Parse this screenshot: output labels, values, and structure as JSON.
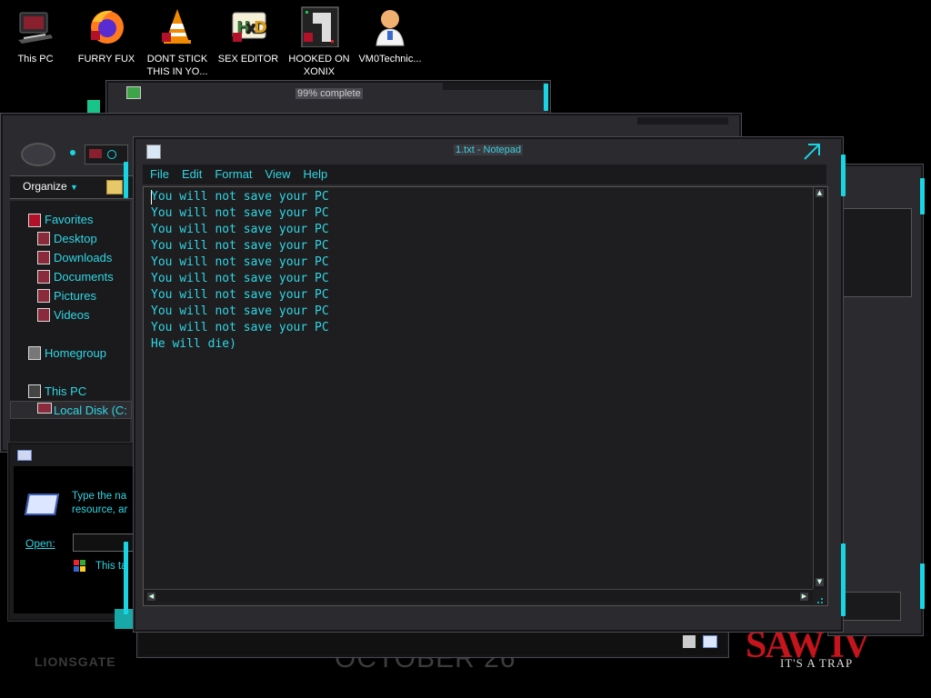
{
  "desktop": {
    "icons": [
      {
        "label_line1": "This PC",
        "label_line2": ""
      },
      {
        "label_line1": "FURRY FUX",
        "label_line2": ""
      },
      {
        "label_line1": "DONT STICK",
        "label_line2": "THIS IN YO..."
      },
      {
        "label_line1": "SEX EDITOR",
        "label_line2": ""
      },
      {
        "label_line1": "HOOKED ON",
        "label_line2": "XONIX"
      },
      {
        "label_line1": "VM0Technic...",
        "label_line2": ""
      }
    ],
    "wallpaper": {
      "studio": "LIONSGATE",
      "date": "OCTOBER 26",
      "movie": "SAW IV",
      "tagline": "IT'S A TRAP"
    }
  },
  "copy_dialog": {
    "title": "99% complete"
  },
  "explorer": {
    "organize_label": "Organize",
    "nav": {
      "favorites": "Favorites",
      "desktop": "Desktop",
      "downloads": "Downloads",
      "documents": "Documents",
      "pictures": "Pictures",
      "videos": "Videos",
      "homegroup": "Homegroup",
      "this_pc": "This PC",
      "local_disk": "Local Disk (C:"
    }
  },
  "run_dialog": {
    "description_line1": "Type the na",
    "description_line2": "resource, ar",
    "open_label": "Open:",
    "admin_note": "This ta"
  },
  "notepad": {
    "title": "1.txt - Notepad",
    "menu": [
      "File",
      "Edit",
      "Format",
      "View",
      "Help"
    ],
    "lines": [
      "You will not save your PC",
      "You will not save your PC",
      "You will not save your PC",
      "You will not save your PC",
      "You will not save your PC",
      "You will not save your PC",
      "You will not save your PC",
      "You will not save your PC",
      "You will not save your PC",
      "He will die)"
    ]
  },
  "colors": {
    "accent": "#19d5e3",
    "text": "#2fd6e4",
    "chrome": "#2b2b2f",
    "editor_bg": "#1e1e20"
  }
}
